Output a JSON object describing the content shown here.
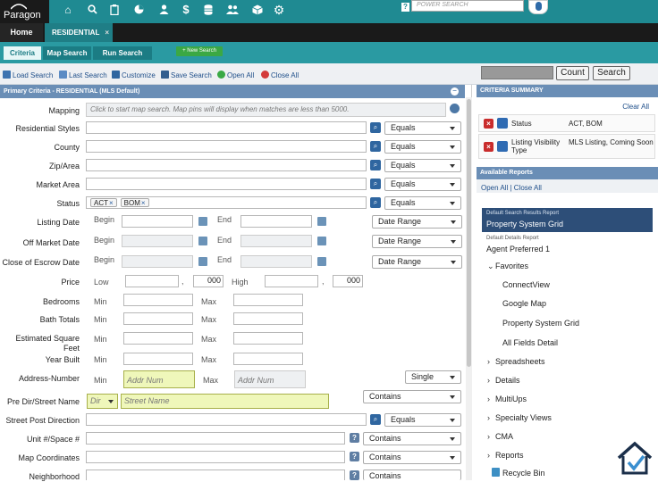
{
  "app": {
    "logo": "Paragon"
  },
  "topbar": {
    "power_search_placeholder": "POWER SEARCH",
    "help_label": "?",
    "icons": [
      "home-icon",
      "search-icon",
      "clipboard-icon",
      "pie-chart-icon",
      "person-icon",
      "dollar-icon",
      "database-icon",
      "people-icon",
      "cube-icon",
      "gear-icon",
      "microphone-icon"
    ]
  },
  "tabs": {
    "home": "Home",
    "residential": "RESIDENTIAL",
    "close": "×"
  },
  "subtabs": {
    "criteria": "Criteria",
    "map_search": "Map Search",
    "run_search": "Run Search",
    "new_search": "+ New Search"
  },
  "toolbar": {
    "load_search": "Load Search",
    "last_search": "Last Search",
    "customize": "Customize",
    "save_search": "Save Search",
    "open_all": "Open All",
    "close_all": "Close All",
    "count": "Count",
    "search": "Search"
  },
  "panel": {
    "title": "Primary Criteria - RESIDENTIAL (MLS Default)",
    "mapping_label": "Mapping",
    "mapping_hint": "Click to start map search. Map pins will display when matches are less than 5000.",
    "rows": {
      "residential_styles": "Residential Styles",
      "county": "County",
      "zip": "Zip/Area",
      "market_area": "Market Area",
      "status": "Status",
      "listing_date": "Listing Date",
      "off_market": "Off Market Date",
      "escrow": "Close of Escrow Date",
      "price": "Price",
      "bedrooms": "Bedrooms",
      "bath": "Bath Totals",
      "sqft": "Estimated Square Feet",
      "year": "Year Built",
      "address_number": "Address-Number",
      "pre_dir": "Pre Dir/Street Name",
      "post_dir": "Street Post Direction",
      "unit": "Unit #/Space #",
      "map_coords": "Map Coordinates",
      "neighborhood": "Neighborhood"
    },
    "ops": {
      "equals": "Equals",
      "date_range": "Date Range",
      "single": "Single",
      "contains": "Contains"
    },
    "status_chips": [
      "ACT",
      "BOM"
    ],
    "chip_close": "×",
    "begin": "Begin",
    "end": "End",
    "low": "Low",
    "high": "High",
    "min": "Min",
    "max": "Max",
    "comma": ",",
    "price_low_suffix": "000",
    "price_high_suffix": "000",
    "addr_num_placeholder": "Addr Num",
    "dir_placeholder": "Dir",
    "street_name_placeholder": "Street Name",
    "question": "?"
  },
  "criteria_summary": {
    "title": "CRITERIA SUMMARY",
    "clear_all": "Clear All",
    "items": [
      {
        "name": "Status",
        "value": "ACT, BOM"
      },
      {
        "name": "Listing Visibility Type",
        "value": "MLS Listing, Coming Soon"
      }
    ]
  },
  "reports": {
    "title": "Available Reports",
    "open_all": "Open All",
    "separator": "|",
    "close_all": "Close All",
    "default_search_label": "Default Search Results Report",
    "default_search_value": "Property System Grid",
    "default_details_label": "Default Details Report",
    "default_details_value": "Agent Preferred 1",
    "favorites": "Favorites",
    "favorite_items": [
      "ConnectView",
      "Google Map",
      "Property System Grid",
      "All Fields Detail"
    ],
    "groups": [
      "Spreadsheets",
      "Details",
      "MultiUps",
      "Specialty Views",
      "CMA",
      "Reports"
    ],
    "recycle_bin": "Recycle Bin"
  },
  "colors": {
    "teal": "#1f8a92",
    "header_blue": "#6a8eb6",
    "highlight": "#eff7ba"
  }
}
